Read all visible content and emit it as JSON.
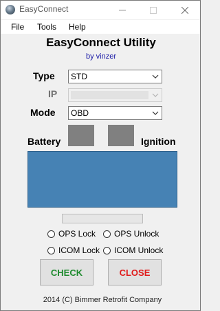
{
  "window": {
    "title": "EasyConnect"
  },
  "menu": {
    "file": "File",
    "tools": "Tools",
    "help": "Help"
  },
  "header": {
    "title": "EasyConnect Utility",
    "byline": "by vinzer"
  },
  "form": {
    "type_label": "Type",
    "type_value": "STD",
    "ip_label": "IP",
    "ip_value": "",
    "mode_label": "Mode",
    "mode_value": "OBD"
  },
  "status": {
    "battery_label": "Battery",
    "ignition_label": "Ignition"
  },
  "progress": {
    "value": 0
  },
  "options": {
    "ops_lock": "OPS Lock",
    "ops_unlock": "OPS Unlock",
    "icom_lock": "ICOM Lock",
    "icom_unlock": "ICOM Unlock"
  },
  "buttons": {
    "check": "CHECK",
    "close": "CLOSE"
  },
  "colors": {
    "check": "#1e8a2e",
    "close": "#e01b1b",
    "display": "#4682b4",
    "indicator": "#808080"
  },
  "footer": {
    "text": "2014 (C) Bimmer Retrofit Company"
  }
}
